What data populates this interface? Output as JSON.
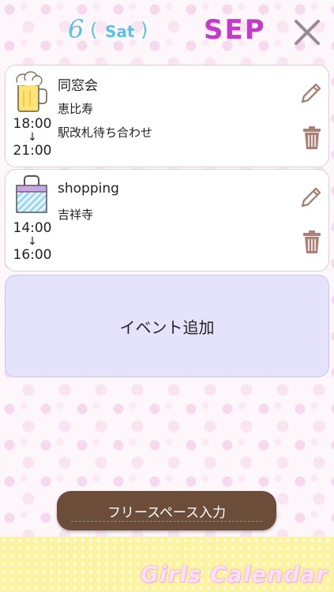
{
  "header": {
    "day": "6",
    "paren_open": "(",
    "weekday": "Sat",
    "paren_close": ")",
    "month": "SEP",
    "close_icon": "close-icon"
  },
  "events": [
    {
      "icon": "beer-mug-icon",
      "title": "同窓会",
      "lines": [
        "恵比寿",
        "駅改札待ち合わせ"
      ],
      "start": "18:00",
      "arrow": "↓",
      "end": "21:00"
    },
    {
      "icon": "shopping-bag-icon",
      "title": "shopping",
      "lines": [
        "吉祥寺"
      ],
      "start": "14:00",
      "arrow": "↓",
      "end": "16:00"
    }
  ],
  "add_event_label": "イベント追加",
  "free_space_label": "フリースペース入力",
  "brand": "Girls Calendar",
  "colors": {
    "accent_blue": "#5fc1e0",
    "month_purple": "#c23bc9",
    "action_icon": "#a88278",
    "button_brown": "#6b4d3a",
    "add_event_bg": "#e4e3fb"
  }
}
